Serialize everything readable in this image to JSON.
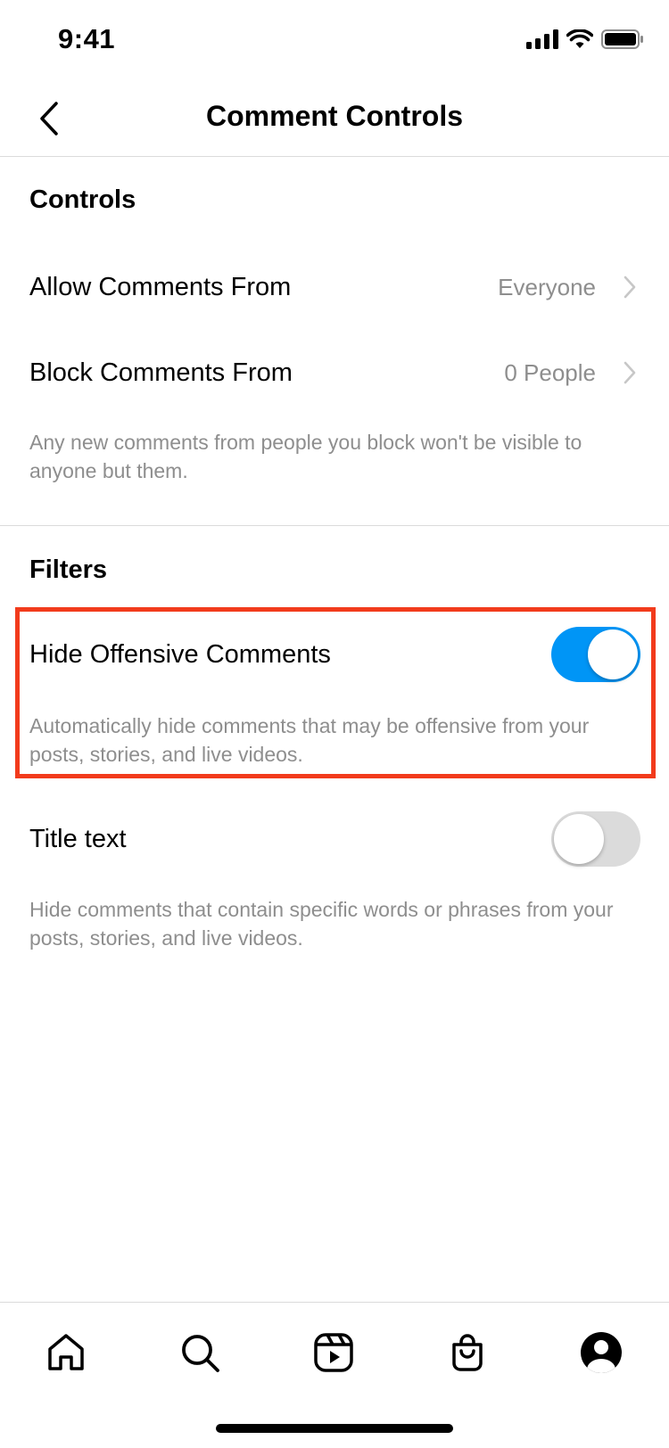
{
  "status_bar": {
    "time": "9:41"
  },
  "nav": {
    "title": "Comment Controls"
  },
  "controls": {
    "header": "Controls",
    "allow_label": "Allow Comments From",
    "allow_value": "Everyone",
    "block_label": "Block Comments From",
    "block_value": "0 People",
    "helper": "Any new comments from people you block won't be visible to anyone but them."
  },
  "filters": {
    "header": "Filters",
    "offensive_label": "Hide Offensive Comments",
    "offensive_on": true,
    "offensive_helper": "Automatically hide comments that may be offensive from your posts, stories, and live videos.",
    "manual_label": "Title text",
    "manual_on": false,
    "manual_helper": "Hide comments that contain specific words or phrases from your posts, stories, and live videos."
  },
  "tab_bar": {
    "items": [
      "home-icon",
      "search-icon",
      "reels-icon",
      "shop-icon",
      "profile-icon"
    ]
  },
  "colors": {
    "accent": "#0095f6",
    "highlight": "#f23b1c",
    "secondary_text": "#8e8e8e",
    "divider": "#dbdbdb"
  }
}
